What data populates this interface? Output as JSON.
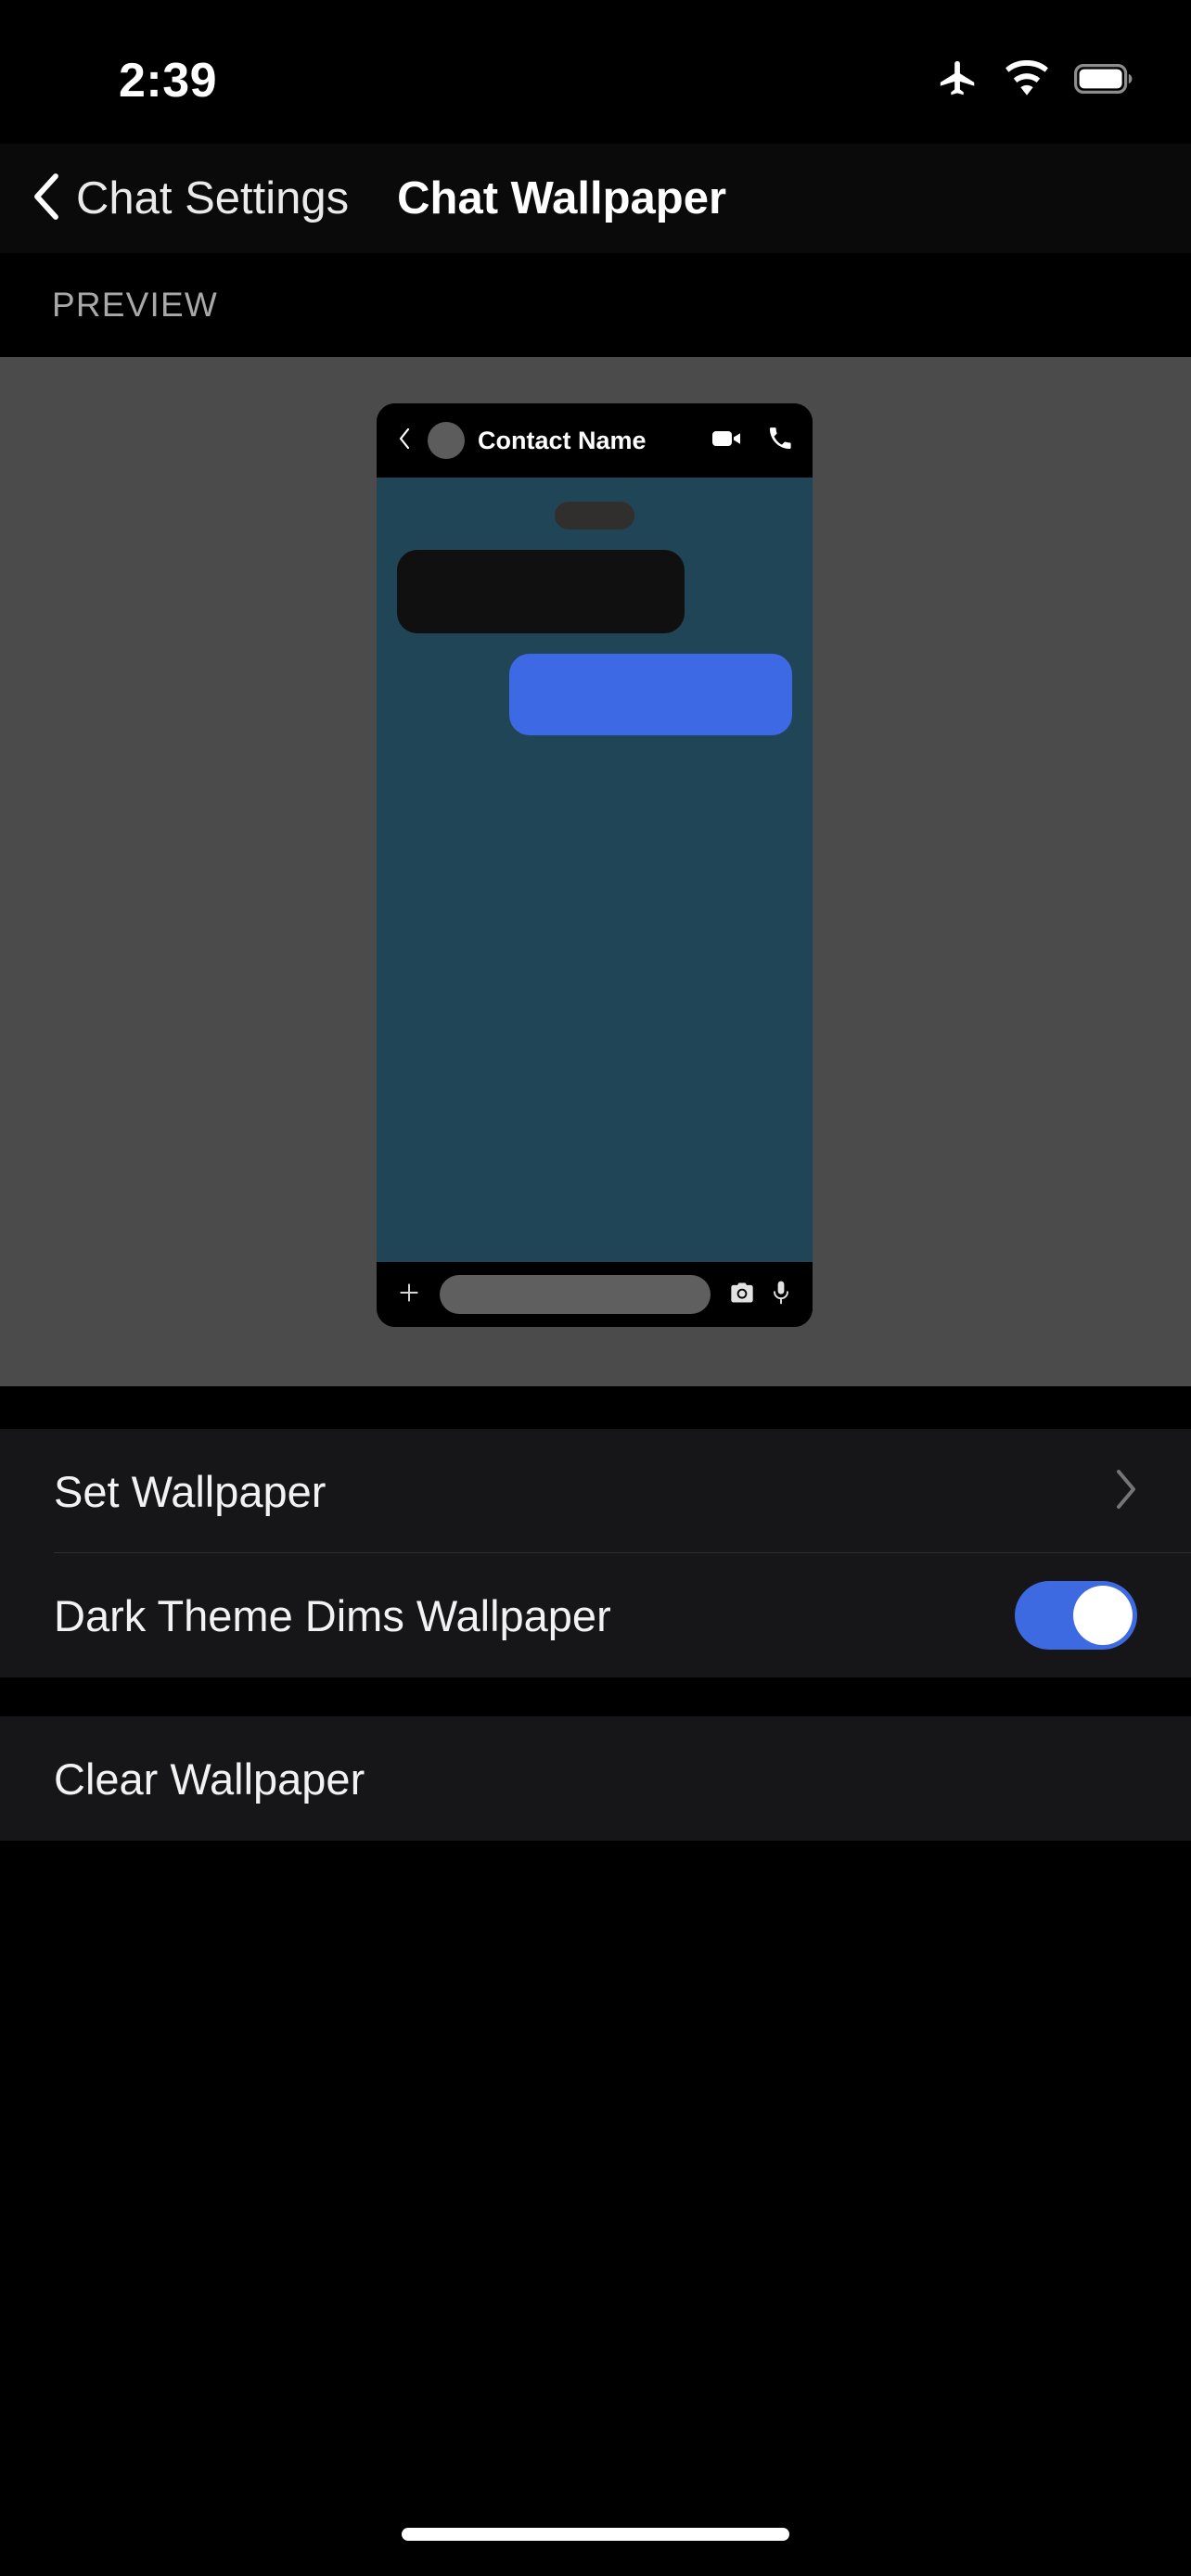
{
  "status_bar": {
    "time": "2:39",
    "icons": [
      "airplane-mode-icon",
      "wifi-icon",
      "battery-full-icon"
    ]
  },
  "nav_bar": {
    "back_label": "Chat Settings",
    "back_icon": "chevron-left-icon",
    "title": "Chat Wallpaper"
  },
  "preview": {
    "section_label": "PREVIEW",
    "stage_background": "#4b4b4b",
    "phone": {
      "header": {
        "back_icon": "chevron-left-icon",
        "avatar": "contact-avatar",
        "contact_name": "Contact Name",
        "video_call_icon": "video-camera-icon",
        "voice_call_icon": "phone-icon"
      },
      "wallpaper_color": "#204556",
      "messages": [
        {
          "type": "date-pill",
          "color": "#302f2e"
        },
        {
          "type": "incoming-bubble",
          "color": "#101010"
        },
        {
          "type": "outgoing-bubble",
          "color": "#3d69e4"
        }
      ],
      "input_bar": {
        "attach_icon": "plus-icon",
        "text_field_placeholder": "",
        "camera_icon": "camera-icon",
        "mic_icon": "microphone-icon"
      }
    }
  },
  "settings": {
    "group_one": [
      {
        "label": "Set Wallpaper",
        "accessory": "chevron-right-icon",
        "name": "set-wallpaper"
      },
      {
        "label": "Dark Theme Dims Wallpaper",
        "accessory": "toggle-switch",
        "toggle_on": true,
        "name": "dark-theme-dims-wallpaper"
      }
    ],
    "group_two": [
      {
        "label": "Clear Wallpaper",
        "accessory": "none",
        "name": "clear-wallpaper"
      }
    ]
  },
  "colors": {
    "accent_blue": "#3d6ae0",
    "row_background": "#161618",
    "page_background": "#000000",
    "wallpaper_teal": "#204556"
  },
  "home_indicator": "home-indicator-bar"
}
